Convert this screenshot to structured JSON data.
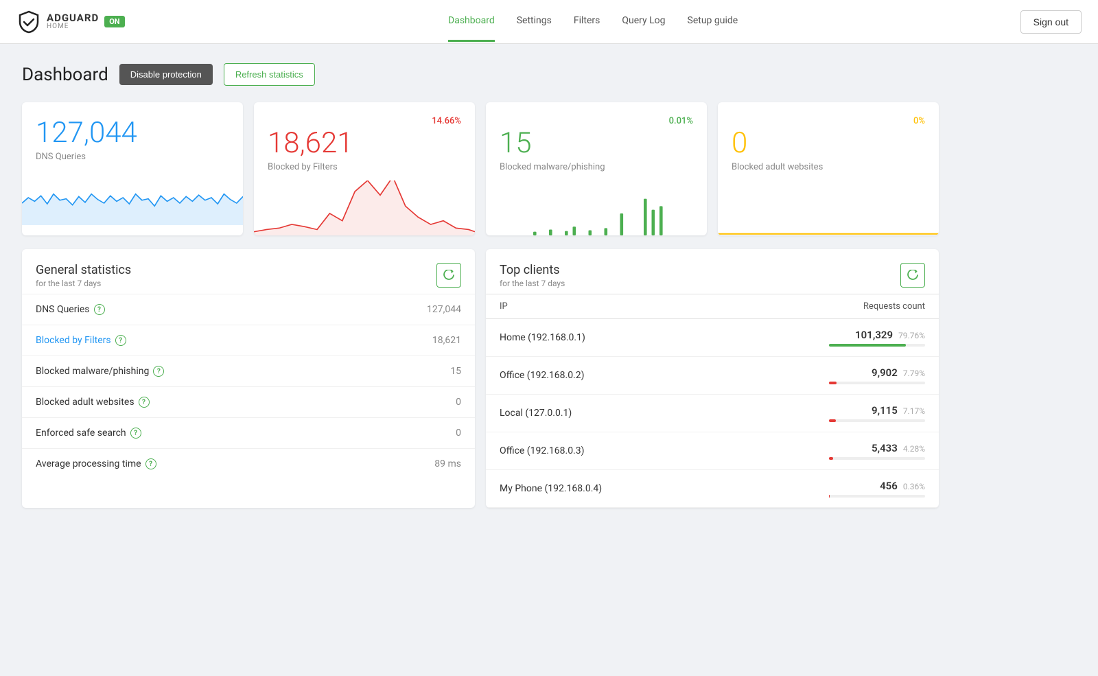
{
  "brand": {
    "name": "ADGUARD",
    "sub": "HOME",
    "badge": "ON"
  },
  "nav": {
    "links": [
      "Dashboard",
      "Settings",
      "Filters",
      "Query Log",
      "Setup guide"
    ],
    "active": "Dashboard",
    "sign_out": "Sign out"
  },
  "page": {
    "title": "Dashboard",
    "disable_btn": "Disable protection",
    "refresh_btn": "Refresh statistics"
  },
  "stat_cards": [
    {
      "value": "127,044",
      "label": "DNS Queries",
      "percent": "",
      "percent_color": "",
      "value_color": "#2196f3",
      "chart_color": "#2196f3",
      "chart_fill": "rgba(33,150,243,0.15)",
      "type": "dns"
    },
    {
      "value": "18,621",
      "label": "Blocked by Filters",
      "percent": "14.66%",
      "percent_color": "#e53935",
      "value_color": "#e53935",
      "chart_color": "#e53935",
      "chart_fill": "rgba(229,57,53,0.1)",
      "type": "blocked"
    },
    {
      "value": "15",
      "label": "Blocked malware/phishing",
      "percent": "0.01%",
      "percent_color": "#4caf50",
      "value_color": "#4caf50",
      "chart_color": "#4caf50",
      "chart_fill": "rgba(76,175,80,0.1)",
      "type": "malware"
    },
    {
      "value": "0",
      "label": "Blocked adult websites",
      "percent": "0%",
      "percent_color": "#ffc107",
      "value_color": "#ffc107",
      "chart_color": "#ffc107",
      "chart_fill": "rgba(255,193,7,0.1)",
      "type": "adult"
    }
  ],
  "general_stats": {
    "title": "General statistics",
    "subtitle": "for the last 7 days",
    "rows": [
      {
        "label": "DNS Queries",
        "value": "127,044",
        "blue": false
      },
      {
        "label": "Blocked by Filters",
        "value": "18,621",
        "blue": true
      },
      {
        "label": "Blocked malware/phishing",
        "value": "15",
        "blue": false
      },
      {
        "label": "Blocked adult websites",
        "value": "0",
        "blue": false
      },
      {
        "label": "Enforced safe search",
        "value": "0",
        "blue": false
      },
      {
        "label": "Average processing time",
        "value": "89 ms",
        "blue": false
      }
    ]
  },
  "top_clients": {
    "title": "Top clients",
    "subtitle": "for the last 7 days",
    "col_ip": "IP",
    "col_requests": "Requests count",
    "rows": [
      {
        "name": "Home (192.168.0.1)",
        "count": "101,329",
        "pct": "79.76%",
        "bar_pct": 79.76,
        "bar_color": "bar-green"
      },
      {
        "name": "Office (192.168.0.2)",
        "count": "9,902",
        "pct": "7.79%",
        "bar_pct": 7.79,
        "bar_color": "bar-red"
      },
      {
        "name": "Local (127.0.0.1)",
        "count": "9,115",
        "pct": "7.17%",
        "bar_pct": 7.17,
        "bar_color": "bar-red"
      },
      {
        "name": "Office (192.168.0.3)",
        "count": "5,433",
        "pct": "4.28%",
        "bar_pct": 4.28,
        "bar_color": "bar-red"
      },
      {
        "name": "My Phone (192.168.0.4)",
        "count": "456",
        "pct": "0.36%",
        "bar_pct": 0.36,
        "bar_color": "bar-red"
      }
    ]
  }
}
